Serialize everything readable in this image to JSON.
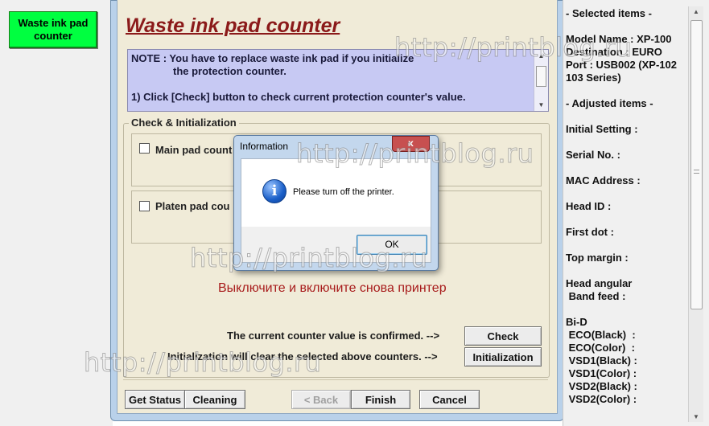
{
  "sidebar": {
    "waste_ink_button": "Waste ink pad\ncounter"
  },
  "main": {
    "title": "Waste ink pad counter",
    "note_line1": "NOTE : You have to replace waste ink pad if you initialize",
    "note_line2": "the protection counter.",
    "note_line3": "1) Click [Check] button to check current protection counter's value.",
    "group_label": "Check & Initialization",
    "main_pad_label": "Main pad count",
    "platen_pad_label": "Platen pad cou",
    "russian_notice": "Выключите и включите снова принтер",
    "confirmed_text": "The current counter value is confirmed. -->",
    "init_text": "Initialization will clear the selected above counters. -->",
    "check_button": "Check",
    "initialization_button": "Initialization",
    "get_status_button": "Get Status",
    "cleaning_button": "Cleaning",
    "back_button": "< Back",
    "finish_button": "Finish",
    "cancel_button": "Cancel"
  },
  "dialog": {
    "title": "Information",
    "close_label": "x",
    "message": "Please turn off the printer.",
    "ok_button": "OK",
    "icon": "info-icon"
  },
  "right_panel": {
    "selected_header": "- Selected items -",
    "model_block": "Model Name : XP-100\nDestination : EURO\nPort : USB002 (XP-102\n103 Series)",
    "adjusted_header": "- Adjusted items -",
    "initial_setting": "Initial Setting :",
    "serial_no": "Serial No. :",
    "mac_address": "MAC Address :",
    "head_id": "Head ID :",
    "first_dot": "First dot :",
    "top_margin": "Top margin :",
    "head_angular": "Head angular\n Band feed :",
    "bid_block": "Bi-D\n ECO(Black)  :\n ECO(Color)  :\n VSD1(Black) :\n VSD1(Color) :\n VSD2(Black) :\n VSD2(Color) :"
  },
  "watermark": {
    "text": "http://printblog.ru"
  }
}
